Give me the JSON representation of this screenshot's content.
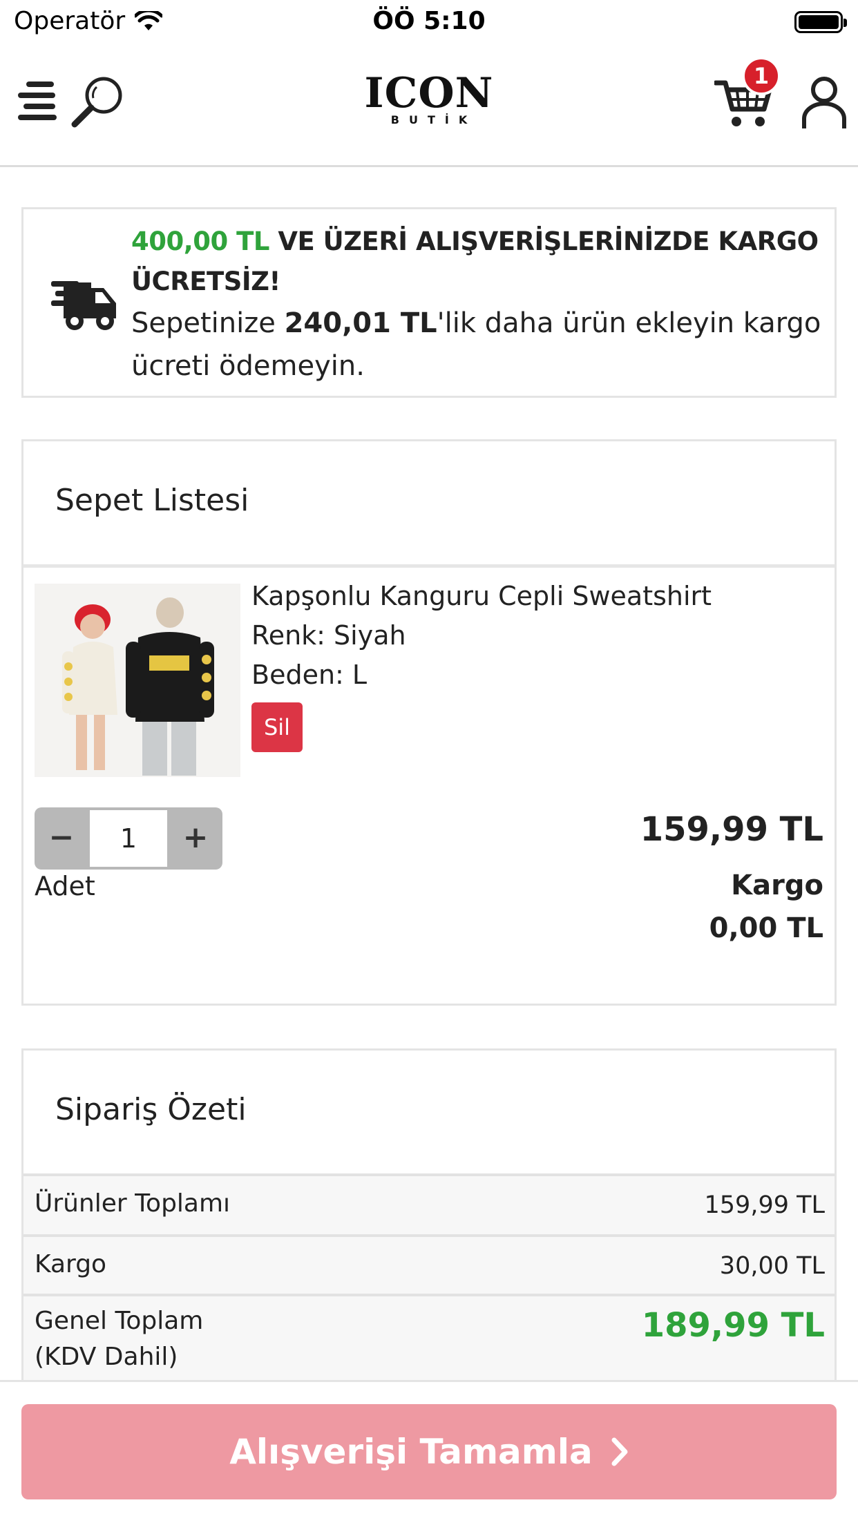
{
  "status_bar": {
    "carrier": "Operatör",
    "time": "ÖÖ 5:10"
  },
  "header": {
    "logo_main": "ICON",
    "logo_sub": "BUTİK",
    "cart_count": "1",
    "icons": [
      "menu-icon",
      "search-icon",
      "cart-icon",
      "user-icon"
    ]
  },
  "shipping_notice": {
    "threshold": "400,00 TL",
    "headline_rest": "VE ÜZERİ ALIŞVERİŞLERİNİZDE KARGO ÜCRETSİZ!",
    "message_prefix": "Sepetinize",
    "remaining": "240,01 TL",
    "message_suffix": "'lik daha ürün ekleyin kargo ücreti ödemeyin."
  },
  "cart": {
    "title": "Sepet Listesi",
    "item": {
      "name": "Kapşonlu Kanguru Cepli Sweatshirt",
      "color": "Renk: Siyah",
      "size": "Beden: L",
      "delete_label": "Sil",
      "quantity": "1",
      "minus_label": "−",
      "plus_label": "+",
      "quantity_label": "Adet",
      "price": "159,99 TL",
      "shipping_label": "Kargo",
      "shipping_fee": "0,00 TL"
    }
  },
  "summary": {
    "title": "Sipariş Özeti",
    "products_total_label": "Ürünler Toplamı",
    "products_total": "159,99 TL",
    "shipping_label": "Kargo",
    "shipping": "30,00 TL",
    "grand_total_label_1": "Genel Toplam",
    "grand_total_label_2": "(KDV Dahil)",
    "grand_total": "189,99 TL"
  },
  "checkout": {
    "label": "Alışverişi Tamamla"
  },
  "colors": {
    "accent_green": "#2fa33b",
    "delete_red": "#dc3545",
    "badge_red": "#d7202b",
    "checkout_pink": "#ee99a2"
  }
}
